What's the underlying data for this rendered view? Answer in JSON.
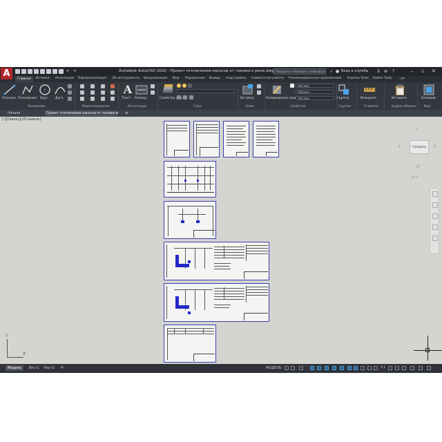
{
  "app": {
    "logo": "A",
    "title": "Autodesk AutoCAD 2020 - Проект отключения насосов от токового реле.dwg",
    "search_placeholder": "Введите ключевое слово/фразу",
    "user": "Вход в службы",
    "help": "?"
  },
  "ribbon_tabs": [
    "Главная",
    "Вставка",
    "Аннотации",
    "Параметризация",
    "3D инструменты",
    "Визуализация",
    "Вид",
    "Управление",
    "Вывод",
    "Надстройки",
    "Совместная работа",
    "Рекомендованные приложения",
    "Express Tools",
    "Raster Tools"
  ],
  "ribbon": {
    "draw": {
      "tools": [
        "Отрезок",
        "Полилиния",
        "Круг",
        "Дуга"
      ],
      "group_label": "Рисование"
    },
    "modify": {
      "group_label": "Редактирование"
    },
    "annotation": {
      "tools": [
        "Текст",
        "Размер"
      ],
      "group_label": "Аннотации"
    },
    "layers": {
      "tool": "Свойства слоя",
      "group_label": "Слои"
    },
    "block": {
      "tool": "Вставка",
      "group_label": "Блок"
    },
    "properties": {
      "tool": "Копирование свойств",
      "combo_color": "ПоСлою",
      "combo_linetype": "ПоБлоку",
      "combo_lineweight": "ПоСлою",
      "group_label": "Свойства"
    },
    "groups": {
      "tool": "Группа",
      "group_label": "Группы"
    },
    "utilities": {
      "tool": "Измерить",
      "group_label": "Утилиты"
    },
    "clipboard": {
      "tool": "Вставить",
      "group_label": "Буфер обмена"
    },
    "view": {
      "tool": "Базовый",
      "group_label": "Вид"
    }
  },
  "file_tabs": [
    "Начало",
    "Проект отключения насосов от токового реле*"
  ],
  "viewport": {
    "label": "[-][Сверху][2D-каркас]",
    "navcube_face": "Сверху",
    "compass": {
      "north": "С",
      "south": "Ю",
      "west": "З",
      "east": "В"
    },
    "wcs": "МСК",
    "ucs_x": "X",
    "ucs_y": "Y"
  },
  "layout_tabs": [
    "Модель",
    "Лист1",
    "Лист2"
  ],
  "status": {
    "model": "МОДЕЛЬ",
    "scale": "1:1"
  },
  "colors": {
    "app_bg": "#2f3238",
    "canvas": "#d4d4d1",
    "sheet_border": "#3a3fb0",
    "accent_blue": "#2429c8",
    "logo_red": "#b2262a"
  }
}
